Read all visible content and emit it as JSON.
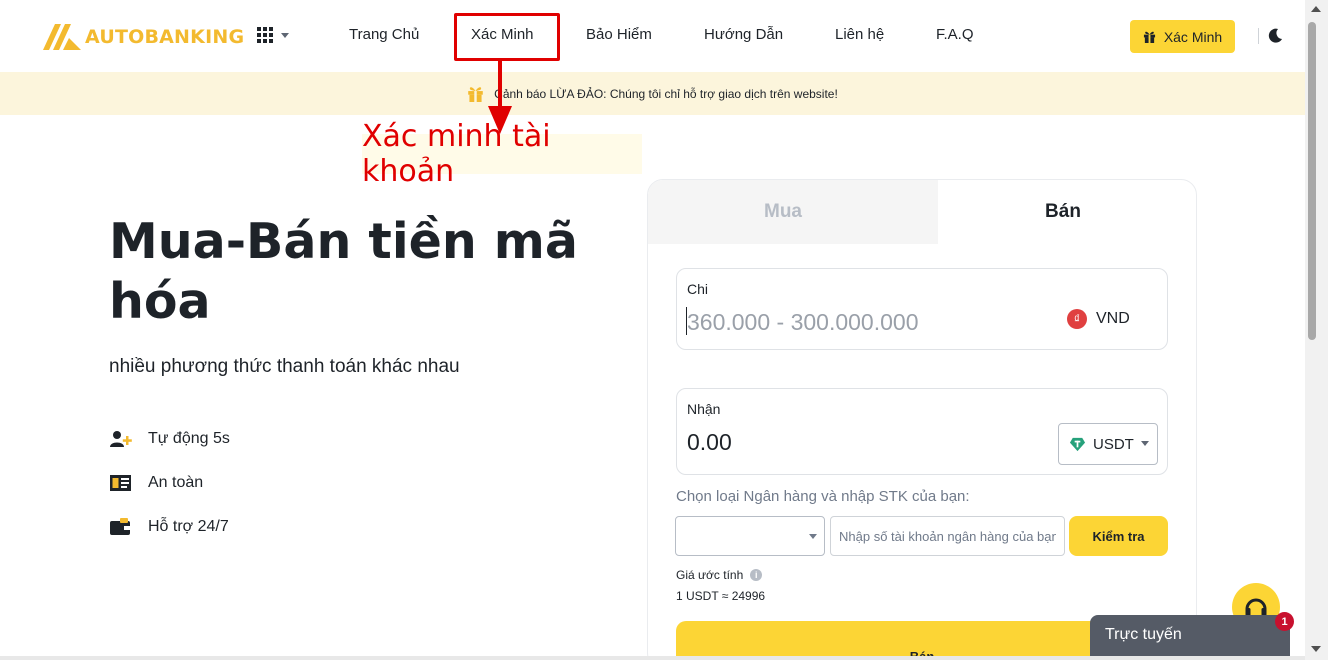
{
  "brand": {
    "name": "AUTOBANKING",
    "color": "#f3ba2f",
    "accent": "#fcd535"
  },
  "nav": {
    "items": [
      "Trang Chủ",
      "Xác Minh",
      "Bảo Hiểm",
      "Hướng Dẫn",
      "Liên hệ",
      "F.A.Q"
    ],
    "verify_button": "Xác Minh"
  },
  "banner": {
    "text": "Cảnh báo LỪA ĐẢO: Chúng tôi chỉ hỗ trợ giao dịch trên website!"
  },
  "annotation": {
    "text": "Xác minh tài khoản",
    "color": "#e00000"
  },
  "hero": {
    "title": "Mua-Bán tiền mã hóa",
    "subtitle": "nhiều phương thức thanh toán khác nhau",
    "features": [
      "Tự động 5s",
      "An toàn",
      "Hỗ trợ 24/7"
    ]
  },
  "trade": {
    "tabs": {
      "buy": "Mua",
      "sell": "Bán"
    },
    "spend": {
      "label": "Chi",
      "placeholder": "360.000 - 300.000.000",
      "currency": "VND",
      "currency_icon": "₫"
    },
    "receive": {
      "label": "Nhận",
      "value": "0.00",
      "currency": "USDT"
    },
    "bank_hint": "Chọn loại Ngân hàng và nhập STK của bạn:",
    "account_placeholder": "Nhập số tài khoản ngân hàng của bạn",
    "check_button": "Kiểm tra",
    "rate_label": "Giá ước tính",
    "rate_value": "1 USDT ≈ 24996",
    "submit_button": "Bán"
  },
  "chat": {
    "label": "Trực tuyến",
    "badge": "1"
  }
}
